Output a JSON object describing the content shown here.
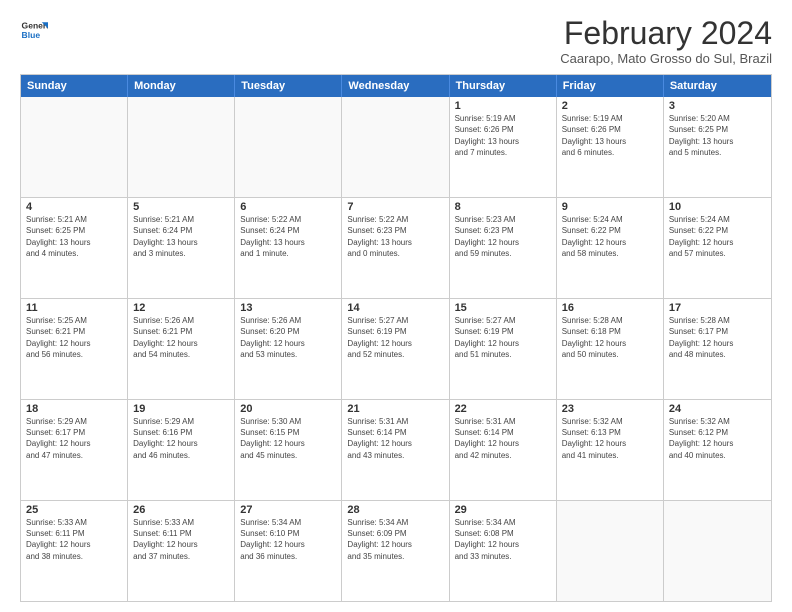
{
  "logo": {
    "line1": "General",
    "line2": "Blue"
  },
  "title": "February 2024",
  "location": "Caarapo, Mato Grosso do Sul, Brazil",
  "days_of_week": [
    "Sunday",
    "Monday",
    "Tuesday",
    "Wednesday",
    "Thursday",
    "Friday",
    "Saturday"
  ],
  "weeks": [
    [
      {
        "day": "",
        "info": ""
      },
      {
        "day": "",
        "info": ""
      },
      {
        "day": "",
        "info": ""
      },
      {
        "day": "",
        "info": ""
      },
      {
        "day": "1",
        "info": "Sunrise: 5:19 AM\nSunset: 6:26 PM\nDaylight: 13 hours\nand 7 minutes."
      },
      {
        "day": "2",
        "info": "Sunrise: 5:19 AM\nSunset: 6:26 PM\nDaylight: 13 hours\nand 6 minutes."
      },
      {
        "day": "3",
        "info": "Sunrise: 5:20 AM\nSunset: 6:25 PM\nDaylight: 13 hours\nand 5 minutes."
      }
    ],
    [
      {
        "day": "4",
        "info": "Sunrise: 5:21 AM\nSunset: 6:25 PM\nDaylight: 13 hours\nand 4 minutes."
      },
      {
        "day": "5",
        "info": "Sunrise: 5:21 AM\nSunset: 6:24 PM\nDaylight: 13 hours\nand 3 minutes."
      },
      {
        "day": "6",
        "info": "Sunrise: 5:22 AM\nSunset: 6:24 PM\nDaylight: 13 hours\nand 1 minute."
      },
      {
        "day": "7",
        "info": "Sunrise: 5:22 AM\nSunset: 6:23 PM\nDaylight: 13 hours\nand 0 minutes."
      },
      {
        "day": "8",
        "info": "Sunrise: 5:23 AM\nSunset: 6:23 PM\nDaylight: 12 hours\nand 59 minutes."
      },
      {
        "day": "9",
        "info": "Sunrise: 5:24 AM\nSunset: 6:22 PM\nDaylight: 12 hours\nand 58 minutes."
      },
      {
        "day": "10",
        "info": "Sunrise: 5:24 AM\nSunset: 6:22 PM\nDaylight: 12 hours\nand 57 minutes."
      }
    ],
    [
      {
        "day": "11",
        "info": "Sunrise: 5:25 AM\nSunset: 6:21 PM\nDaylight: 12 hours\nand 56 minutes."
      },
      {
        "day": "12",
        "info": "Sunrise: 5:26 AM\nSunset: 6:21 PM\nDaylight: 12 hours\nand 54 minutes."
      },
      {
        "day": "13",
        "info": "Sunrise: 5:26 AM\nSunset: 6:20 PM\nDaylight: 12 hours\nand 53 minutes."
      },
      {
        "day": "14",
        "info": "Sunrise: 5:27 AM\nSunset: 6:19 PM\nDaylight: 12 hours\nand 52 minutes."
      },
      {
        "day": "15",
        "info": "Sunrise: 5:27 AM\nSunset: 6:19 PM\nDaylight: 12 hours\nand 51 minutes."
      },
      {
        "day": "16",
        "info": "Sunrise: 5:28 AM\nSunset: 6:18 PM\nDaylight: 12 hours\nand 50 minutes."
      },
      {
        "day": "17",
        "info": "Sunrise: 5:28 AM\nSunset: 6:17 PM\nDaylight: 12 hours\nand 48 minutes."
      }
    ],
    [
      {
        "day": "18",
        "info": "Sunrise: 5:29 AM\nSunset: 6:17 PM\nDaylight: 12 hours\nand 47 minutes."
      },
      {
        "day": "19",
        "info": "Sunrise: 5:29 AM\nSunset: 6:16 PM\nDaylight: 12 hours\nand 46 minutes."
      },
      {
        "day": "20",
        "info": "Sunrise: 5:30 AM\nSunset: 6:15 PM\nDaylight: 12 hours\nand 45 minutes."
      },
      {
        "day": "21",
        "info": "Sunrise: 5:31 AM\nSunset: 6:14 PM\nDaylight: 12 hours\nand 43 minutes."
      },
      {
        "day": "22",
        "info": "Sunrise: 5:31 AM\nSunset: 6:14 PM\nDaylight: 12 hours\nand 42 minutes."
      },
      {
        "day": "23",
        "info": "Sunrise: 5:32 AM\nSunset: 6:13 PM\nDaylight: 12 hours\nand 41 minutes."
      },
      {
        "day": "24",
        "info": "Sunrise: 5:32 AM\nSunset: 6:12 PM\nDaylight: 12 hours\nand 40 minutes."
      }
    ],
    [
      {
        "day": "25",
        "info": "Sunrise: 5:33 AM\nSunset: 6:11 PM\nDaylight: 12 hours\nand 38 minutes."
      },
      {
        "day": "26",
        "info": "Sunrise: 5:33 AM\nSunset: 6:11 PM\nDaylight: 12 hours\nand 37 minutes."
      },
      {
        "day": "27",
        "info": "Sunrise: 5:34 AM\nSunset: 6:10 PM\nDaylight: 12 hours\nand 36 minutes."
      },
      {
        "day": "28",
        "info": "Sunrise: 5:34 AM\nSunset: 6:09 PM\nDaylight: 12 hours\nand 35 minutes."
      },
      {
        "day": "29",
        "info": "Sunrise: 5:34 AM\nSunset: 6:08 PM\nDaylight: 12 hours\nand 33 minutes."
      },
      {
        "day": "",
        "info": ""
      },
      {
        "day": "",
        "info": ""
      }
    ]
  ]
}
